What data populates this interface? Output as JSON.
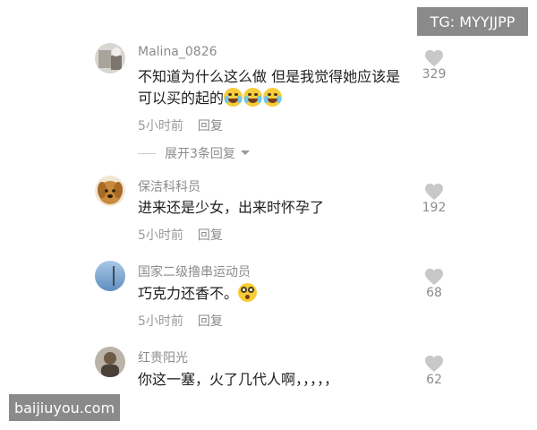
{
  "watermarks": {
    "top": "TG: MYYJJPP",
    "bottom": "baijiuyou.com"
  },
  "comments": [
    {
      "username": "Malina_0826",
      "text_line1": "不知道为什么这么做 但是我觉得她应该是",
      "text_line2": "可以买的起的",
      "emoji_count": 3,
      "emoji": "laugh-cry-emoji",
      "time": "5小时前",
      "reply": "回复",
      "likes": "329",
      "expand": "展开3条回复"
    },
    {
      "username": "保洁科科员",
      "text": "进来还是少女，出来时怀孕了",
      "time": "5小时前",
      "reply": "回复",
      "likes": "192"
    },
    {
      "username": "国家二级撸串运动员",
      "text": "巧克力还香不。",
      "emoji": "surprised-emoji",
      "time": "5小时前",
      "reply": "回复",
      "likes": "68"
    },
    {
      "username": "红贵阳光",
      "text": "你这一塞，火了几代人啊，，，，，",
      "likes": "62"
    }
  ],
  "colors": {
    "text": "#1e1e1e",
    "secondary": "#8c8c8c",
    "heart": "#c8c8c8",
    "watermark_bg": "#8a8a8a"
  },
  "icons": {
    "like": "heart-icon",
    "expand": "chevron-down-icon"
  }
}
